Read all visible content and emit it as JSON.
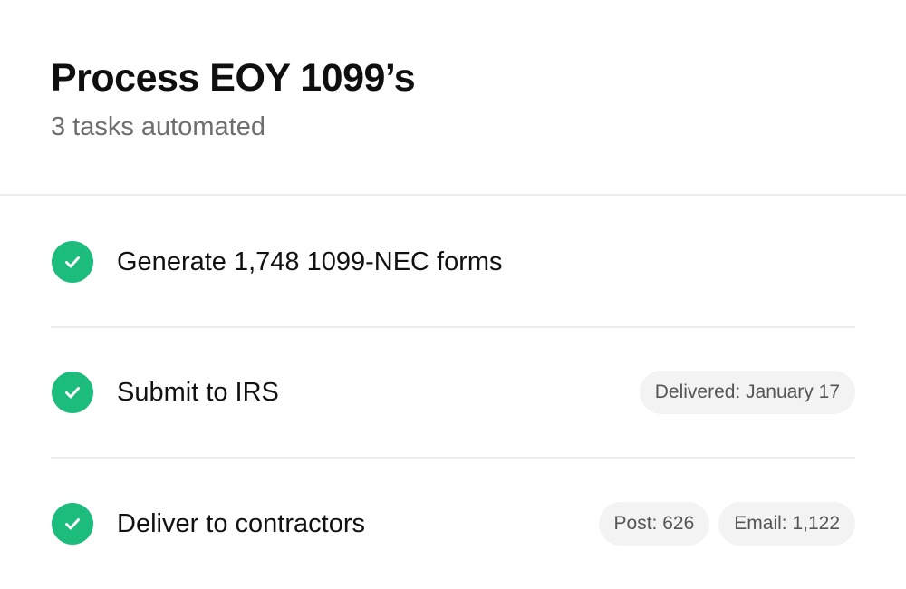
{
  "header": {
    "title": "Process EOY 1099’s",
    "subtitle": "3 tasks automated"
  },
  "tasks": [
    {
      "label": "Generate 1,748 1099-NEC forms",
      "status_icon": "check-circle-icon",
      "badges": []
    },
    {
      "label": "Submit to IRS",
      "status_icon": "check-circle-icon",
      "badges": [
        "Delivered: January 17"
      ]
    },
    {
      "label": "Deliver to contractors",
      "status_icon": "check-circle-icon",
      "badges": [
        "Post: 626",
        "Email: 1,122"
      ]
    }
  ],
  "colors": {
    "success": "#1cbc7c",
    "badge_bg": "#f3f3f3",
    "divider": "#ececec",
    "subtitle": "#6e6e6e"
  }
}
